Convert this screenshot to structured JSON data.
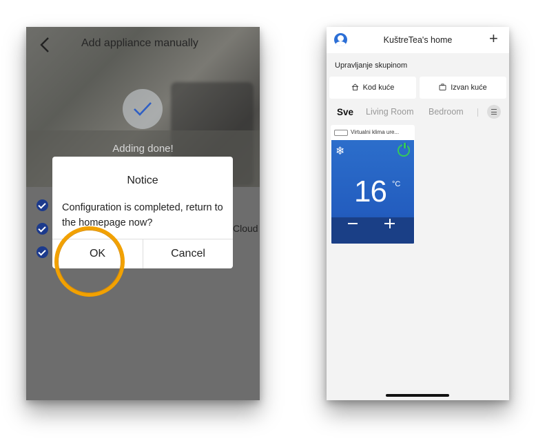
{
  "left_screen": {
    "header": {
      "title": "Add appliance manually"
    },
    "status": {
      "text": "Adding done!"
    },
    "steps_partial_text": "Cloud",
    "dialog": {
      "title": "Notice",
      "message": "Configuration is completed, return to the homepage now?",
      "ok_label": "OK",
      "cancel_label": "Cancel"
    },
    "highlight_color": "#f2a100"
  },
  "right_screen": {
    "header": {
      "title": "KuštreTea's home",
      "add_icon": "plus-icon"
    },
    "group_control": {
      "label": "Upravljanje skupinom",
      "buttons": [
        {
          "label": "Kod kuće"
        },
        {
          "label": "Izvan kuće"
        }
      ]
    },
    "tabs": [
      {
        "label": "Sve",
        "active": true
      },
      {
        "label": "Living Room"
      },
      {
        "label": "Bedroom"
      }
    ],
    "device_card": {
      "name": "Virtualni klima ure...",
      "mode_icon": "snowflake-icon",
      "power_icon": "power-icon",
      "temperature": "16",
      "unit": "°C",
      "minus_label": "−",
      "plus_label": "+"
    },
    "accent_color": "#2c6ecb",
    "power_color": "#35c95a"
  }
}
